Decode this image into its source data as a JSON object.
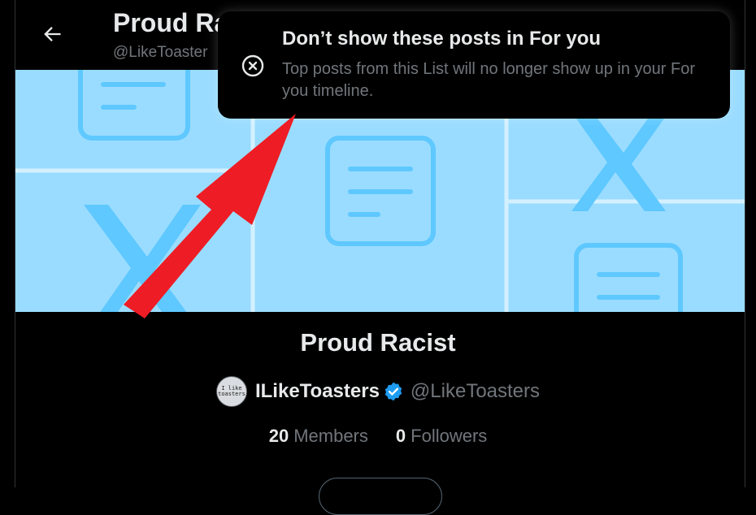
{
  "header": {
    "title": "Proud Ra",
    "handle": "@LikeToaster",
    "back_icon": "arrow-left-icon"
  },
  "toast": {
    "title": "Don’t show these posts in For you",
    "body": "Top posts from this List will no longer show up in your For you timeline.",
    "icon": "x-circle-icon"
  },
  "list": {
    "name": "Proud Racist",
    "owner_name": "ILikeToasters",
    "owner_handle": "@LikeToasters",
    "avatar_text": "I like toasters",
    "verified_color": "#1d9bf0"
  },
  "stats": {
    "members_count": "20",
    "members_label": "Members",
    "followers_count": "0",
    "followers_label": "Followers"
  },
  "colors": {
    "banner_bg": "#9adcff",
    "banner_icon": "#5ec8ff",
    "annotation_arrow": "#ee1c25"
  }
}
